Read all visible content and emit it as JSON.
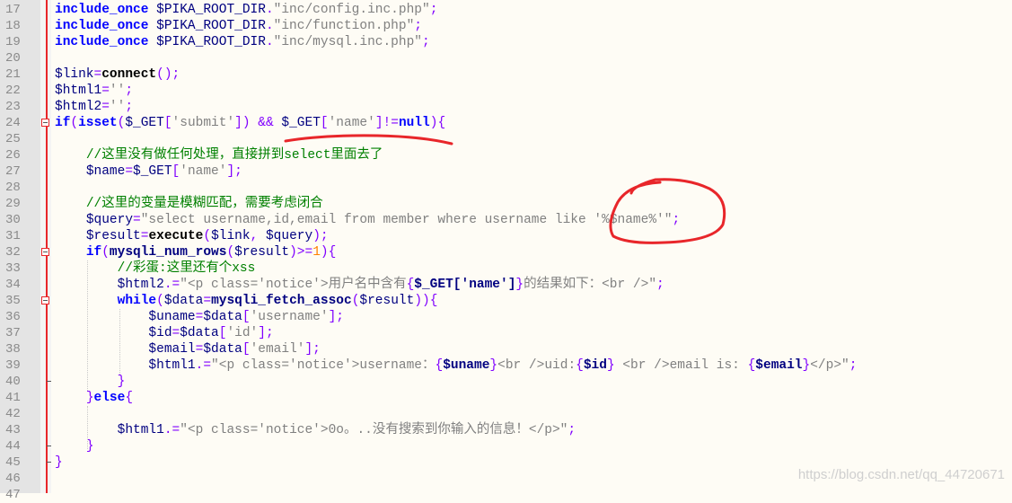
{
  "editor": {
    "colors": {
      "keyword": "#0000ff",
      "variable": "#000080",
      "string": "#808080",
      "operator": "#8000ff",
      "comment": "#008000",
      "annotation": "#e8262a"
    },
    "lines": [
      {
        "n": "17",
        "t": [
          [
            "kw",
            "include_once"
          ],
          [
            "pl",
            " "
          ],
          [
            "var",
            "$PIKA_ROOT_DIR"
          ],
          [
            "op",
            "."
          ],
          [
            "str",
            "\"inc/config.inc.php\""
          ],
          [
            "op",
            ";"
          ]
        ]
      },
      {
        "n": "18",
        "t": [
          [
            "kw",
            "include_once"
          ],
          [
            "pl",
            " "
          ],
          [
            "var",
            "$PIKA_ROOT_DIR"
          ],
          [
            "op",
            "."
          ],
          [
            "str",
            "\"inc/function.php\""
          ],
          [
            "op",
            ";"
          ]
        ]
      },
      {
        "n": "19",
        "t": [
          [
            "kw",
            "include_once"
          ],
          [
            "pl",
            " "
          ],
          [
            "var",
            "$PIKA_ROOT_DIR"
          ],
          [
            "op",
            "."
          ],
          [
            "str",
            "\"inc/mysql.inc.php\""
          ],
          [
            "op",
            ";"
          ]
        ]
      },
      {
        "n": "20",
        "t": []
      },
      {
        "n": "21",
        "t": [
          [
            "var",
            "$link"
          ],
          [
            "op",
            "="
          ],
          [
            "fn",
            "connect"
          ],
          [
            "op",
            "();"
          ]
        ]
      },
      {
        "n": "22",
        "t": [
          [
            "var",
            "$html1"
          ],
          [
            "op",
            "="
          ],
          [
            "str",
            "''"
          ],
          [
            "op",
            ";"
          ]
        ]
      },
      {
        "n": "23",
        "t": [
          [
            "var",
            "$html2"
          ],
          [
            "op",
            "="
          ],
          [
            "str",
            "''"
          ],
          [
            "op",
            ";"
          ]
        ]
      },
      {
        "n": "24",
        "fold": "open",
        "t": [
          [
            "kw",
            "if"
          ],
          [
            "op",
            "("
          ],
          [
            "kw",
            "isset"
          ],
          [
            "op",
            "("
          ],
          [
            "var",
            "$_GET"
          ],
          [
            "op",
            "["
          ],
          [
            "str",
            "'submit'"
          ],
          [
            "op",
            "])"
          ],
          [
            "pl",
            " "
          ],
          [
            "op",
            "&&"
          ],
          [
            "pl",
            " "
          ],
          [
            "var",
            "$_GET"
          ],
          [
            "op",
            "["
          ],
          [
            "str",
            "'name'"
          ],
          [
            "op",
            "]!="
          ],
          [
            "kw",
            "null"
          ],
          [
            "op",
            "){"
          ]
        ]
      },
      {
        "n": "25",
        "t": []
      },
      {
        "n": "26",
        "t": [
          [
            "pl",
            "    "
          ],
          [
            "cm",
            "//这里没有做任何处理，直接拼到select里面去了"
          ]
        ]
      },
      {
        "n": "27",
        "t": [
          [
            "pl",
            "    "
          ],
          [
            "var",
            "$name"
          ],
          [
            "op",
            "="
          ],
          [
            "var",
            "$_GET"
          ],
          [
            "op",
            "["
          ],
          [
            "str",
            "'name'"
          ],
          [
            "op",
            "];"
          ]
        ]
      },
      {
        "n": "28",
        "t": []
      },
      {
        "n": "29",
        "t": [
          [
            "pl",
            "    "
          ],
          [
            "cm",
            "//这里的变量是模糊匹配，需要考虑闭合"
          ]
        ]
      },
      {
        "n": "30",
        "t": [
          [
            "pl",
            "    "
          ],
          [
            "var",
            "$query"
          ],
          [
            "op",
            "="
          ],
          [
            "str",
            "\"select username,id,email from member where username like '%$name%'\""
          ],
          [
            "op",
            ";"
          ]
        ]
      },
      {
        "n": "31",
        "t": [
          [
            "pl",
            "    "
          ],
          [
            "var",
            "$result"
          ],
          [
            "op",
            "="
          ],
          [
            "fn",
            "execute"
          ],
          [
            "op",
            "("
          ],
          [
            "var",
            "$link"
          ],
          [
            "op",
            ","
          ],
          [
            "pl",
            " "
          ],
          [
            "var",
            "$query"
          ],
          [
            "op",
            ");"
          ]
        ]
      },
      {
        "n": "32",
        "fold": "open",
        "t": [
          [
            "pl",
            "    "
          ],
          [
            "kw",
            "if"
          ],
          [
            "op",
            "("
          ],
          [
            "fnb",
            "mysqli_num_rows"
          ],
          [
            "op",
            "("
          ],
          [
            "var",
            "$result"
          ],
          [
            "op",
            ")>="
          ],
          [
            "num1",
            "1"
          ],
          [
            "op",
            "){"
          ]
        ]
      },
      {
        "n": "33",
        "t": [
          [
            "pl",
            "        "
          ],
          [
            "cm",
            "//彩蛋:这里还有个xss"
          ]
        ]
      },
      {
        "n": "34",
        "t": [
          [
            "pl",
            "        "
          ],
          [
            "var",
            "$html2"
          ],
          [
            "op",
            ".="
          ],
          [
            "str",
            "\"<p class='notice'>用户名中含有"
          ],
          [
            "op",
            "{"
          ],
          [
            "fnb",
            "$_GET['name']"
          ],
          [
            "op",
            "}"
          ],
          [
            "str",
            "的结果如下：<br />\""
          ],
          [
            "op",
            ";"
          ]
        ]
      },
      {
        "n": "35",
        "fold": "open",
        "t": [
          [
            "pl",
            "        "
          ],
          [
            "kw",
            "while"
          ],
          [
            "op",
            "("
          ],
          [
            "var",
            "$data"
          ],
          [
            "op",
            "="
          ],
          [
            "fnb",
            "mysqli_fetch_assoc"
          ],
          [
            "op",
            "("
          ],
          [
            "var",
            "$result"
          ],
          [
            "op",
            "))"
          ],
          [
            "op",
            "{"
          ]
        ]
      },
      {
        "n": "36",
        "t": [
          [
            "pl",
            "            "
          ],
          [
            "var",
            "$uname"
          ],
          [
            "op",
            "="
          ],
          [
            "var",
            "$data"
          ],
          [
            "op",
            "["
          ],
          [
            "str",
            "'username'"
          ],
          [
            "op",
            "];"
          ]
        ]
      },
      {
        "n": "37",
        "t": [
          [
            "pl",
            "            "
          ],
          [
            "var",
            "$id"
          ],
          [
            "op",
            "="
          ],
          [
            "var",
            "$data"
          ],
          [
            "op",
            "["
          ],
          [
            "str",
            "'id'"
          ],
          [
            "op",
            "];"
          ]
        ]
      },
      {
        "n": "38",
        "t": [
          [
            "pl",
            "            "
          ],
          [
            "var",
            "$email"
          ],
          [
            "op",
            "="
          ],
          [
            "var",
            "$data"
          ],
          [
            "op",
            "["
          ],
          [
            "str",
            "'email'"
          ],
          [
            "op",
            "];"
          ]
        ]
      },
      {
        "n": "39",
        "t": [
          [
            "pl",
            "            "
          ],
          [
            "var",
            "$html1"
          ],
          [
            "op",
            ".="
          ],
          [
            "str",
            "\"<p class='notice'>username："
          ],
          [
            "op",
            "{"
          ],
          [
            "fnb",
            "$uname"
          ],
          [
            "op",
            "}"
          ],
          [
            "str",
            "<br />uid:"
          ],
          [
            "op",
            "{"
          ],
          [
            "fnb",
            "$id"
          ],
          [
            "op",
            "}"
          ],
          [
            "str",
            " <br />email is: "
          ],
          [
            "op",
            "{"
          ],
          [
            "fnb",
            "$email"
          ],
          [
            "op",
            "}"
          ],
          [
            "str",
            "</p>\""
          ],
          [
            "op",
            ";"
          ]
        ]
      },
      {
        "n": "40",
        "fold": "end",
        "t": [
          [
            "pl",
            "        "
          ],
          [
            "op",
            "}"
          ]
        ]
      },
      {
        "n": "41",
        "t": [
          [
            "pl",
            "    "
          ],
          [
            "op",
            "}"
          ],
          [
            "kw",
            "else"
          ],
          [
            "op",
            "{"
          ]
        ]
      },
      {
        "n": "42",
        "t": []
      },
      {
        "n": "43",
        "t": [
          [
            "pl",
            "        "
          ],
          [
            "var",
            "$html1"
          ],
          [
            "op",
            ".="
          ],
          [
            "str",
            "\"<p class='notice'>0o。..没有搜索到你输入的信息！</p>\""
          ],
          [
            "op",
            ";"
          ]
        ]
      },
      {
        "n": "44",
        "fold": "end",
        "t": [
          [
            "pl",
            "    "
          ],
          [
            "op",
            "}"
          ]
        ]
      },
      {
        "n": "45",
        "fold": "end",
        "t": [
          [
            "op",
            "}"
          ]
        ]
      },
      {
        "n": "46",
        "t": []
      },
      {
        "n": "47",
        "t": []
      }
    ]
  },
  "watermark": "https://blog.csdn.net/qq_44720671"
}
